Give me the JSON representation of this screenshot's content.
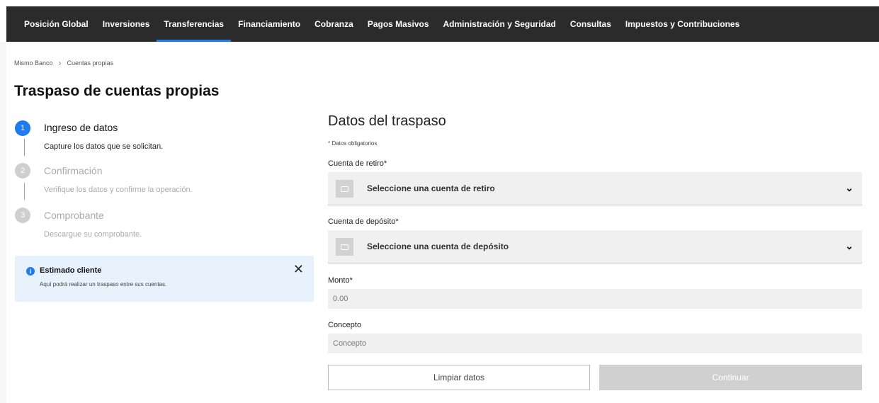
{
  "nav": {
    "items": [
      {
        "label": "Posición Global"
      },
      {
        "label": "Inversiones"
      },
      {
        "label": "Transferencias"
      },
      {
        "label": "Financiamiento"
      },
      {
        "label": "Cobranza"
      },
      {
        "label": "Pagos Masivos"
      },
      {
        "label": "Administración y Seguridad"
      },
      {
        "label": "Consultas"
      },
      {
        "label": "Impuestos y Contribuciones"
      }
    ],
    "active_label": "Transferencias"
  },
  "breadcrumb": {
    "root": "Mismo Banco",
    "current": "Cuentas propias"
  },
  "page_title": "Traspaso de cuentas propias",
  "steps": [
    {
      "number": "1",
      "title": "Ingreso de datos",
      "desc": "Capture los datos que se solicitan.",
      "state": "active"
    },
    {
      "number": "2",
      "title": "Confirmación",
      "desc": "Verifique los datos y confirme la operación.",
      "state": "pending"
    },
    {
      "number": "3",
      "title": "Comprobante",
      "desc": "Descargue su comprobante.",
      "state": "pending"
    }
  ],
  "info": {
    "title": "Estimado cliente",
    "text": "Aquí podrá realizar un traspaso entre sus cuentas."
  },
  "form": {
    "title": "Datos del traspaso",
    "required_note": "* Datos obligatorios",
    "withdraw": {
      "label": "Cuenta de retiro*",
      "value": "Seleccione una cuenta de retiro"
    },
    "deposit": {
      "label": "Cuenta de depósito*",
      "value": "Seleccione una cuenta de depósito"
    },
    "amount": {
      "label": "Monto*",
      "placeholder": "0.00"
    },
    "concept": {
      "label": "Concepto",
      "placeholder": "Concepto"
    },
    "clear_label": "Limpiar datos",
    "continue_label": "Continuar"
  },
  "colors": {
    "nav_bg": "#2b2b2b",
    "accent": "#1d7cf2",
    "info_bg": "#e8f2fc",
    "disabled_button": "#d0d0d0"
  },
  "icons": {
    "breadcrumb_separator": "chevron-right-icon",
    "info": "info-icon",
    "close": "close-icon",
    "account": "account-card-icon",
    "dropdown": "chevron-down-icon"
  }
}
